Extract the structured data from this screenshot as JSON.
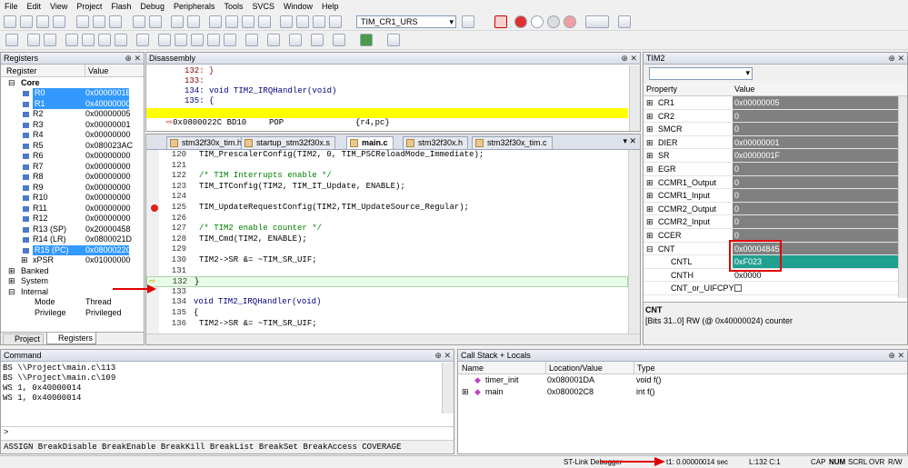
{
  "menu": [
    "File",
    "Edit",
    "View",
    "Project",
    "Flash",
    "Debug",
    "Peripherals",
    "Tools",
    "SVCS",
    "Window",
    "Help"
  ],
  "toolbar": {
    "target_combo": "TIM_CR1_URS"
  },
  "registers": {
    "title": "Registers",
    "col_register": "Register",
    "col_value": "Value",
    "core_label": "Core",
    "rows": [
      {
        "name": "R0",
        "value": "0x0000001E",
        "sel": true
      },
      {
        "name": "R1",
        "value": "0x40000000",
        "sel": true
      },
      {
        "name": "R2",
        "value": "0x00000005"
      },
      {
        "name": "R3",
        "value": "0x00000001"
      },
      {
        "name": "R4",
        "value": "0x00000000"
      },
      {
        "name": "R5",
        "value": "0x080023AC"
      },
      {
        "name": "R6",
        "value": "0x00000000"
      },
      {
        "name": "R7",
        "value": "0x00000000"
      },
      {
        "name": "R8",
        "value": "0x00000000"
      },
      {
        "name": "R9",
        "value": "0x00000000"
      },
      {
        "name": "R10",
        "value": "0x00000000"
      },
      {
        "name": "R11",
        "value": "0x00000000"
      },
      {
        "name": "R12",
        "value": "0x00000000"
      },
      {
        "name": "R13 (SP)",
        "value": "0x20000458"
      },
      {
        "name": "R14 (LR)",
        "value": "0x0800021D"
      },
      {
        "name": "R15 (PC)",
        "value": "0x0800022C",
        "sel": true
      },
      {
        "name": "xPSR",
        "value": "0x01000000"
      }
    ],
    "groups": [
      "Banked",
      "System",
      "Internal"
    ],
    "internal": [
      {
        "name": "Mode",
        "value": "Thread"
      },
      {
        "name": "Privilege",
        "value": "Privileged"
      }
    ],
    "tab_project": "Project",
    "tab_registers": "Registers"
  },
  "disassembly": {
    "title": "Disassembly",
    "lines": [
      "132: }",
      "133:",
      "134: void TIM2_IRQHandler(void)",
      "135: {"
    ],
    "current_addr": "0x0800022C BD10",
    "current_mnem": "POP",
    "current_ops": "{r4,pc}"
  },
  "editor": {
    "tabs": [
      "stm32f30x_tim.h",
      "startup_stm32f30x.s",
      "main.c",
      "stm32f30x.h",
      "stm32f30x_tim.c"
    ],
    "lines": [
      {
        "n": "120",
        "t": "TIM_PrescalerConfig(TIM2, 0, TIM_PSCReloadMode_Immediate);"
      },
      {
        "n": "121",
        "t": ""
      },
      {
        "n": "122",
        "t": "/* TIM Interrupts enable */",
        "c": true
      },
      {
        "n": "123",
        "t": "TIM_ITConfig(TIM2, TIM_IT_Update, ENABLE);"
      },
      {
        "n": "124",
        "t": ""
      },
      {
        "n": "125",
        "t": "TIM_UpdateRequestConfig(TIM2,TIM_UpdateSource_Regular);",
        "bp": true
      },
      {
        "n": "126",
        "t": ""
      },
      {
        "n": "127",
        "t": "/* TIM2 enable counter */",
        "c": true
      },
      {
        "n": "128",
        "t": "TIM_Cmd(TIM2, ENABLE);"
      },
      {
        "n": "129",
        "t": ""
      },
      {
        "n": "130",
        "t": "TIM2->SR &= ~TIM_SR_UIF;"
      },
      {
        "n": "131",
        "t": ""
      },
      {
        "n": "132",
        "t": "}",
        "cur": true
      },
      {
        "n": "133",
        "t": ""
      },
      {
        "n": "134",
        "t": "void TIM2_IRQHandler(void)",
        "f": true
      },
      {
        "n": "135",
        "t": "{"
      },
      {
        "n": "136",
        "t": "TIM2->SR &= ~TIM_SR_UIF;"
      }
    ]
  },
  "tim2": {
    "title": "TIM2",
    "col_property": "Property",
    "col_value": "Value",
    "rows": [
      {
        "name": "CR1",
        "value": "0x00000005"
      },
      {
        "name": "CR2",
        "value": "0"
      },
      {
        "name": "SMCR",
        "value": "0"
      },
      {
        "name": "DIER",
        "value": "0x00000001"
      },
      {
        "name": "SR",
        "value": "0x0000001F"
      },
      {
        "name": "EGR",
        "value": "0"
      },
      {
        "name": "CCMR1_Output",
        "value": "0"
      },
      {
        "name": "CCMR1_Input",
        "value": "0"
      },
      {
        "name": "CCMR2_Output",
        "value": "0"
      },
      {
        "name": "CCMR2_Input",
        "value": "0"
      },
      {
        "name": "CCER",
        "value": "0"
      },
      {
        "name": "CNT",
        "value": "0x00004845",
        "hl": true,
        "open": true
      },
      {
        "name": "CNTL",
        "value": "0xF023",
        "sub": true,
        "teal": true
      },
      {
        "name": "CNTH",
        "value": "0x0000",
        "sub": true,
        "white": true
      },
      {
        "name": "CNT_or_UIFCPY",
        "value": "",
        "sub": true,
        "check": true
      }
    ],
    "desc_title": "CNT",
    "desc_text": "[Bits 31..0] RW (@ 0x40000024) counter"
  },
  "command": {
    "title": "Command",
    "lines": [
      "BS \\\\Project\\main.c\\113",
      "BS \\\\Project\\main.c\\109",
      "WS 1, 0x40000014",
      "WS 1, 0x40000014"
    ],
    "prompt": ">",
    "hint": "ASSIGN BreakDisable BreakEnable BreakKill BreakList BreakSet BreakAccess COVERAGE"
  },
  "callstack": {
    "title": "Call Stack + Locals",
    "col_name": "Name",
    "col_loc": "Location/Value",
    "col_type": "Type",
    "rows": [
      {
        "name": "timer_init",
        "loc": "0x080001DA",
        "type": "void f()"
      },
      {
        "name": "main",
        "loc": "0x080002C8",
        "type": "int f()"
      }
    ]
  },
  "status": {
    "debugger": "ST-Link Debugger",
    "time": "t1: 0.00000014 sec",
    "pos": "L:132 C:1",
    "flags": [
      "CAP",
      "NUM",
      "SCRL",
      "OVR",
      "R/W"
    ]
  },
  "colors": {
    "current_line": "#ffff00",
    "selection": "#3399ff",
    "teal": "#20a090",
    "annotation_red": "#e00000"
  }
}
